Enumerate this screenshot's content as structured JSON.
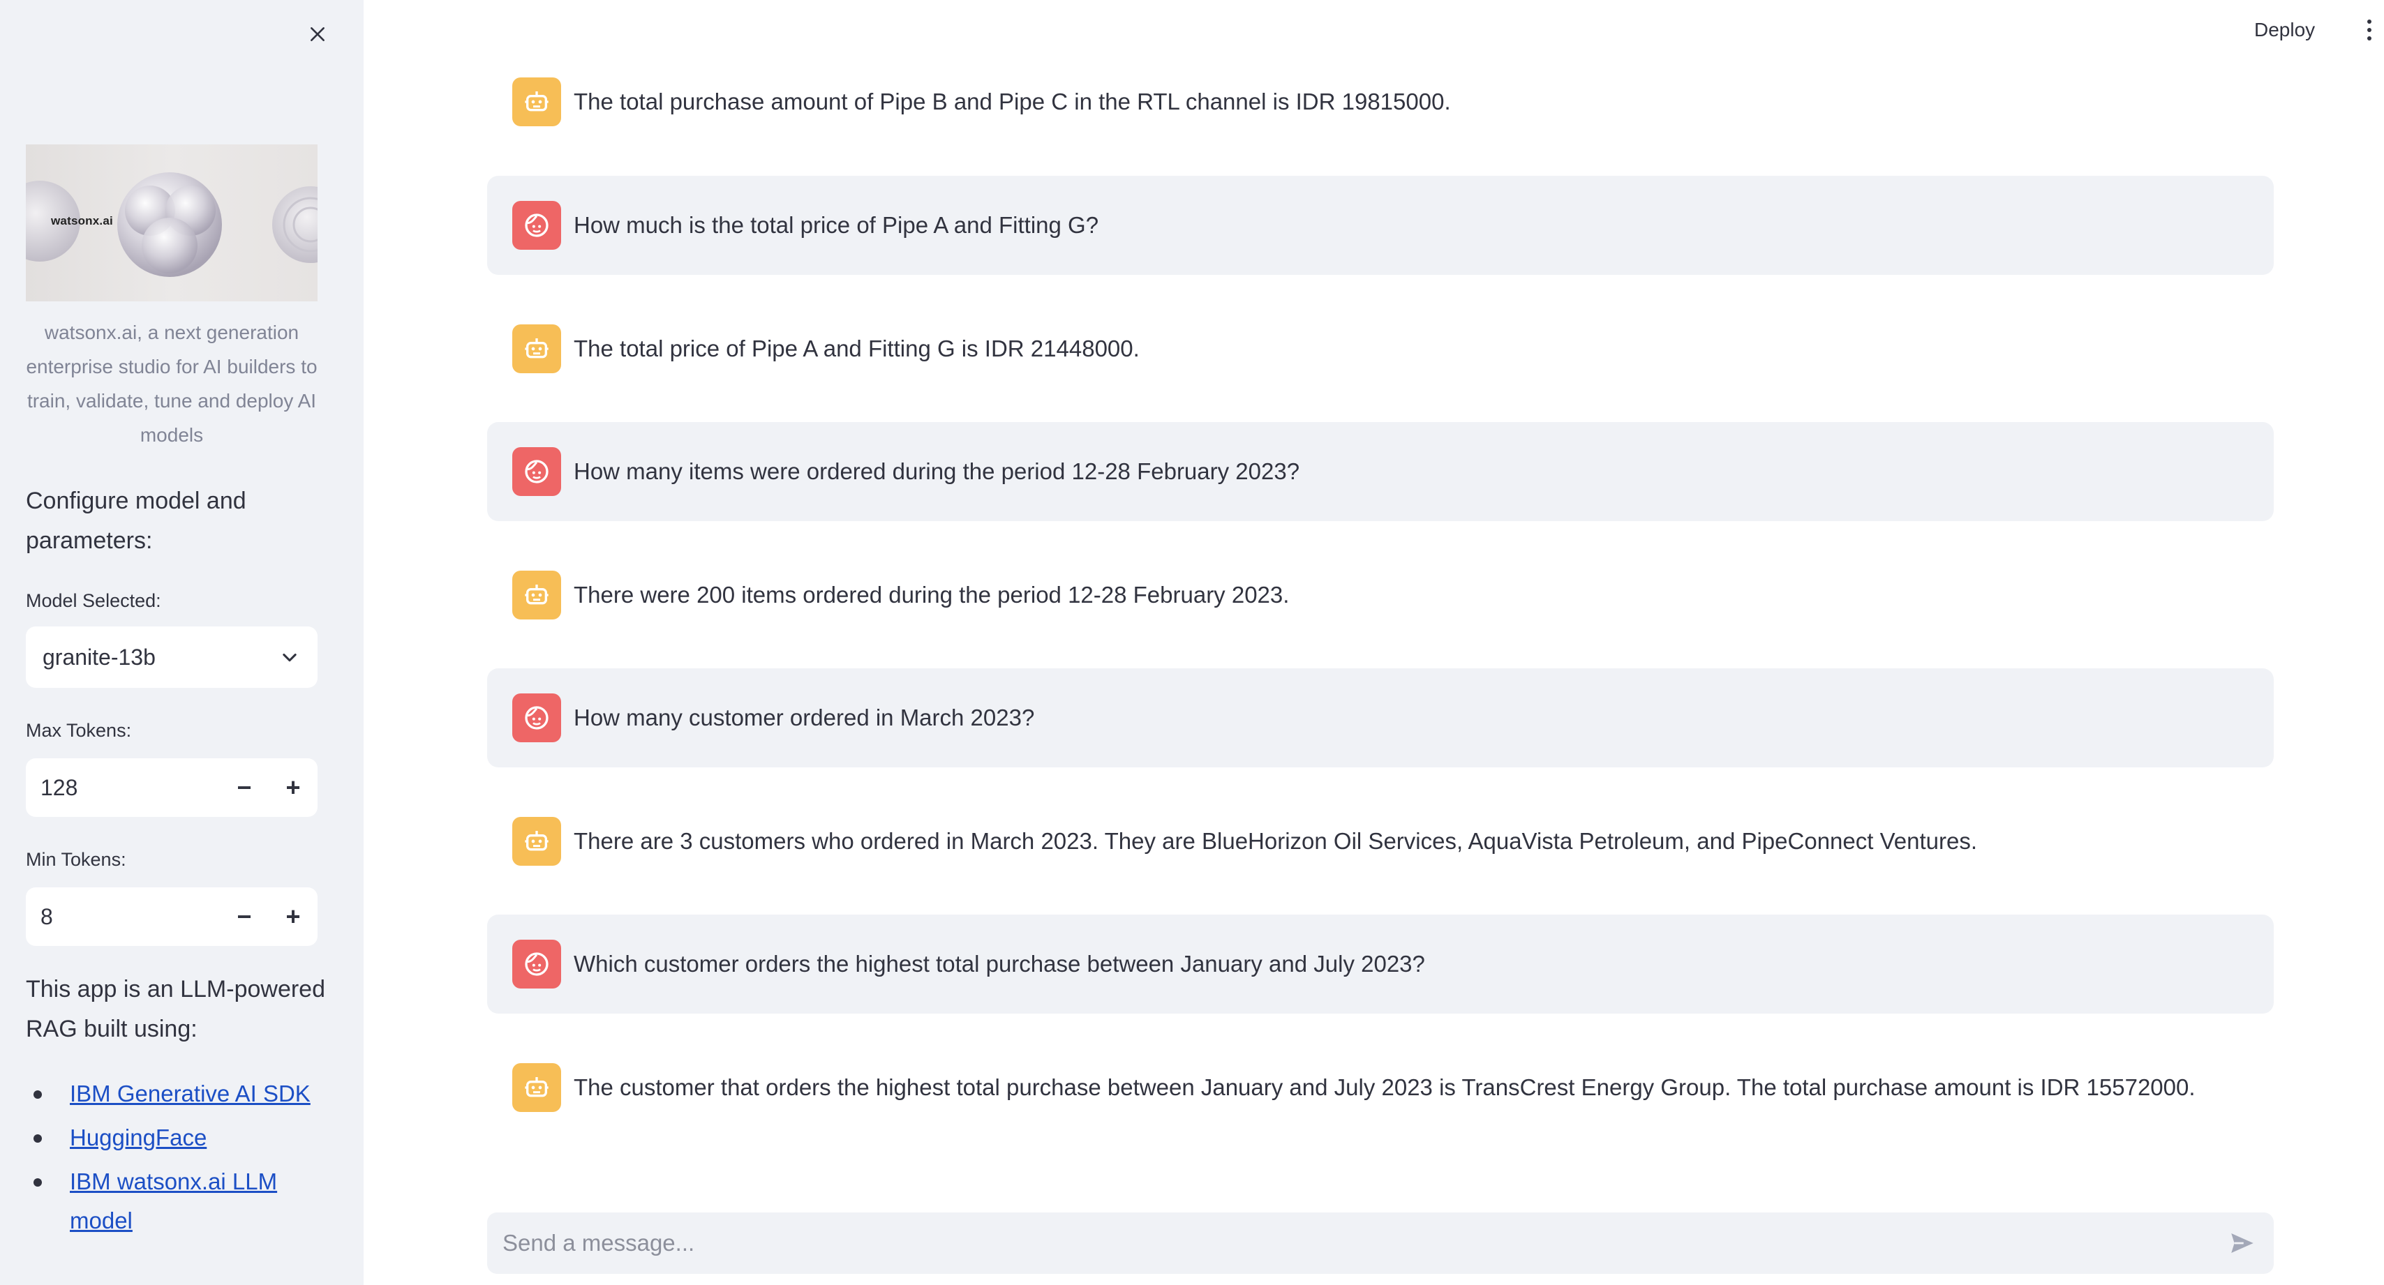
{
  "sidebar": {
    "banner_text": "watsonx.ai",
    "caption": "watsonx.ai, a next generation enterprise studio for AI builders to train, validate, tune and deploy AI models",
    "configure_heading": "Configure model and parameters:",
    "model_label": "Model Selected:",
    "model_value": "granite-13b",
    "max_tokens_label": "Max Tokens:",
    "max_tokens_value": "128",
    "min_tokens_label": "Min Tokens:",
    "min_tokens_value": "8",
    "minus_symbol": "−",
    "plus_symbol": "+",
    "about_text": "This app is an LLM-powered RAG built using:",
    "links": [
      {
        "label": "IBM Generative AI SDK"
      },
      {
        "label": "HuggingFace"
      },
      {
        "label": "IBM watsonx.ai LLM model"
      }
    ]
  },
  "header": {
    "deploy_label": "Deploy"
  },
  "chat": {
    "messages": [
      {
        "role": "assistant",
        "text": "The total purchase amount of Pipe B and Pipe C in the RTL channel is IDR 19815000."
      },
      {
        "role": "user",
        "text": "How much is the total price of Pipe A and Fitting G?"
      },
      {
        "role": "assistant",
        "text": "The total price of Pipe A and Fitting G is IDR 21448000."
      },
      {
        "role": "user",
        "text": "How many items were ordered during the period 12-28 February 2023?"
      },
      {
        "role": "assistant",
        "text": "There were 200 items ordered during the period 12-28 February 2023."
      },
      {
        "role": "user",
        "text": "How many customer ordered in March 2023?"
      },
      {
        "role": "assistant",
        "text": "There are 3 customers who ordered in March 2023. They are BlueHorizon Oil Services, AquaVista Petroleum, and PipeConnect Ventures."
      },
      {
        "role": "user",
        "text": "Which customer orders the highest total purchase between January and July 2023?"
      },
      {
        "role": "assistant",
        "text": "The customer that orders the highest total purchase between January and July 2023 is TransCrest Energy Group. The total purchase amount is IDR 15572000."
      }
    ],
    "input_placeholder": "Send a message..."
  },
  "colors": {
    "sidebar_bg": "#f0f2f6",
    "user_avatar": "#ee6666",
    "assistant_avatar": "#f7be56",
    "link": "#1c4fc5",
    "text": "#31333f"
  },
  "icons": {
    "close": "close-icon",
    "chevron": "chevron-down-icon",
    "user_avatar": "user-face-icon",
    "assistant_avatar": "robot-icon",
    "send": "send-icon",
    "menu": "kebab-menu-icon"
  }
}
